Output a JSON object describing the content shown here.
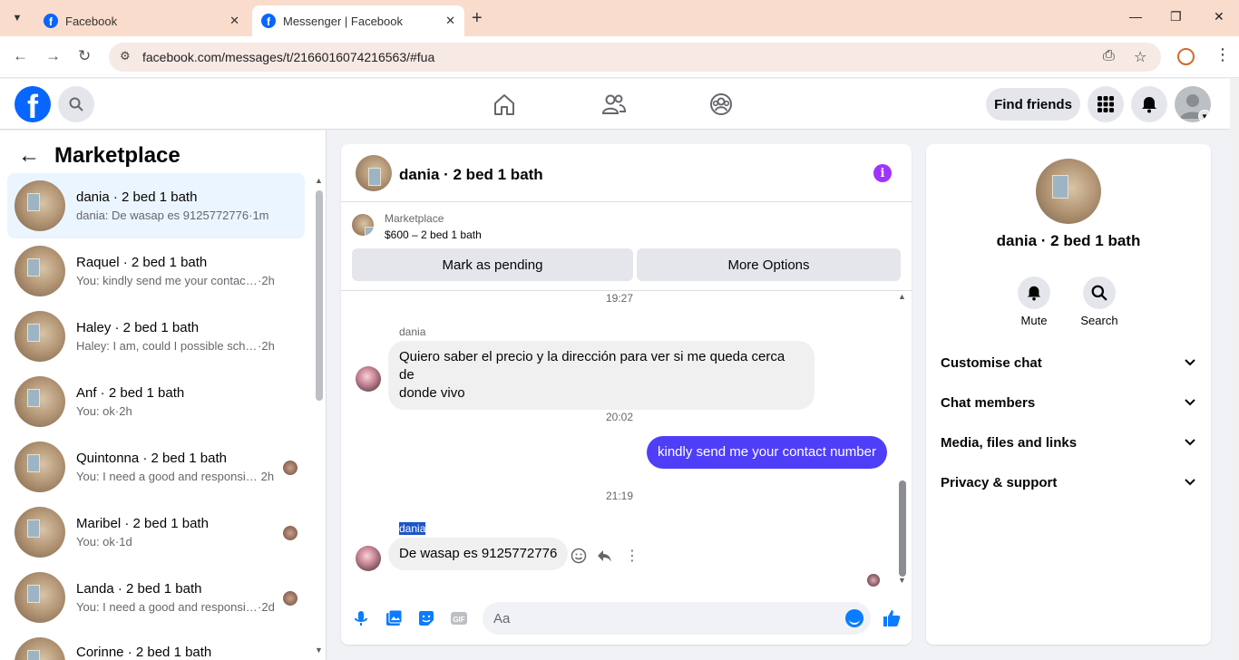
{
  "browser": {
    "tabs": [
      {
        "title": "Facebook"
      },
      {
        "title": "Messenger | Facebook"
      }
    ],
    "url": "facebook.com/messages/t/2166016074216563/#fua"
  },
  "header": {
    "find_friends_label": "Find friends"
  },
  "left_panel": {
    "title": "Marketplace",
    "conversations": [
      {
        "name": "dania · 2 bed 1 bath",
        "preview": "dania: De wasap es 9125772776",
        "time": "1m"
      },
      {
        "name": "Raquel · 2 bed 1 bath",
        "preview": "You: kindly send me your contact n...",
        "time": "2h"
      },
      {
        "name": "Haley · 2 bed 1 bath",
        "preview": "Haley: I am, could I possible sched...",
        "time": "2h"
      },
      {
        "name": "Anf · 2 bed 1 bath",
        "preview": "You: ok",
        "time": "2h"
      },
      {
        "name": "Quintonna · 2 bed 1 bath",
        "preview": "You: I need a good and responsibl...",
        "time": "2h"
      },
      {
        "name": "Maribel · 2 bed 1 bath",
        "preview": "You: ok",
        "time": "1d"
      },
      {
        "name": "Landa · 2 bed 1 bath",
        "preview": "You: I need a good and responsibl...",
        "time": "2d"
      },
      {
        "name": "Corinne · 2 bed 1 bath",
        "preview": "",
        "time": ""
      }
    ]
  },
  "chat": {
    "title": "dania · 2 bed 1 bath",
    "marketplace_label": "Marketplace",
    "listing": "$600 – 2 bed 1 bath",
    "mark_pending_label": "Mark as pending",
    "more_options_label": "More Options",
    "messages": {
      "t1": "19:27",
      "sender1": "dania",
      "m1_line1": "Quiero saber el precio y la dirección para ver si me queda cerca de",
      "m1_line2": "donde vivo",
      "t2": "20:02",
      "m2": "kindly send me your contact number",
      "t3": "21:19",
      "sender2": "dania",
      "m3": "De wasap es 9125772776"
    },
    "composer_placeholder": "Aa"
  },
  "right_panel": {
    "name": "dania · 2 bed 1 bath",
    "mute_label": "Mute",
    "search_label": "Search",
    "sections": [
      "Customise chat",
      "Chat members",
      "Media, files and links",
      "Privacy & support"
    ]
  },
  "colors": {
    "fb_blue": "#0866ff",
    "outgoing_bubble": "#4f3ef7",
    "info_purple": "#a033ff"
  }
}
